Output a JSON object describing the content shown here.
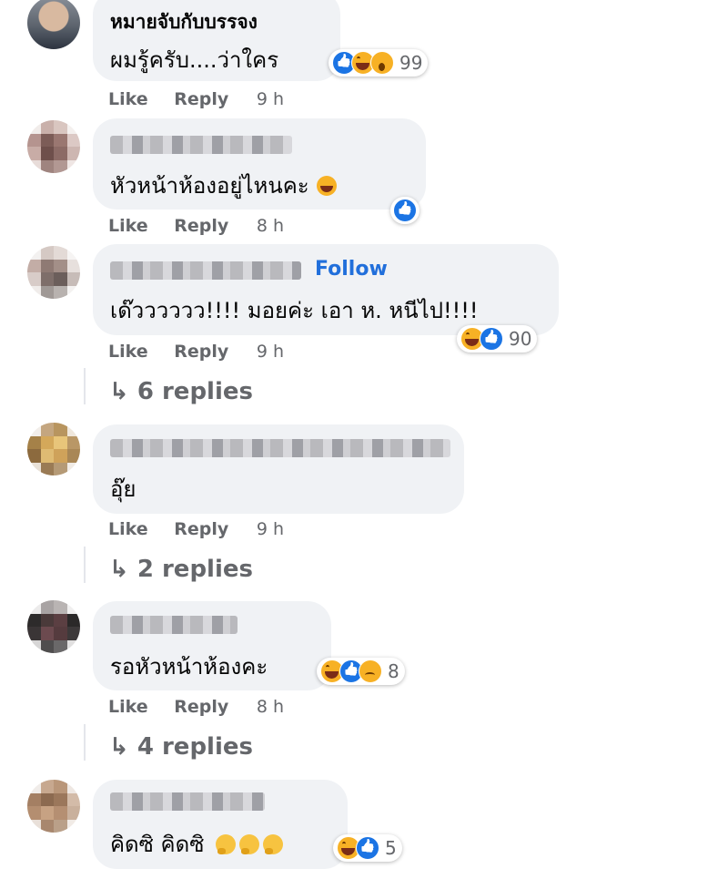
{
  "actions": {
    "like": "Like",
    "reply": "Reply"
  },
  "comments": [
    {
      "name": "หมายจับกับบรรจง",
      "text": "ผมรู้ครับ....ว่าใคร",
      "time": "9 h",
      "reactions": "99",
      "reaction_icons": [
        "like-icon",
        "haha-icon",
        "wow-icon"
      ]
    },
    {
      "name": "",
      "text": "หัวหน้าห้องอยู่ไหนคะ",
      "time": "8 h",
      "reactions": "",
      "reaction_icons": [
        "like-icon"
      ],
      "inline_emoji": "laughing-emoji"
    },
    {
      "name": "",
      "follow": "Follow",
      "text": "เด๊วววววว!!!! มอยค่ะ เอา ห. หนีไป!!!!",
      "time": "9 h",
      "reactions": "90",
      "reaction_icons": [
        "haha-icon",
        "like-icon"
      ],
      "replies": "6 replies"
    },
    {
      "name": "",
      "text": "อุ๊ย",
      "time": "9 h",
      "reactions": "",
      "replies": "2 replies"
    },
    {
      "name": "",
      "text": "รอหัวหน้าห้องคะ",
      "time": "8 h",
      "reactions": "8",
      "reaction_icons": [
        "haha-icon",
        "like-icon",
        "sad-icon"
      ],
      "replies": "4 replies"
    },
    {
      "name": "",
      "text": "คิดซิ คิดซิ",
      "time": "",
      "reactions": "5",
      "reaction_icons": [
        "haha-icon",
        "like-icon"
      ],
      "inline_emoji": "thinking-emoji"
    }
  ],
  "colors": {
    "bubble": "#f0f2f5",
    "link": "#216fdb",
    "meta": "#65676b",
    "like": "#1b74e4",
    "haha": "#f7b125"
  }
}
